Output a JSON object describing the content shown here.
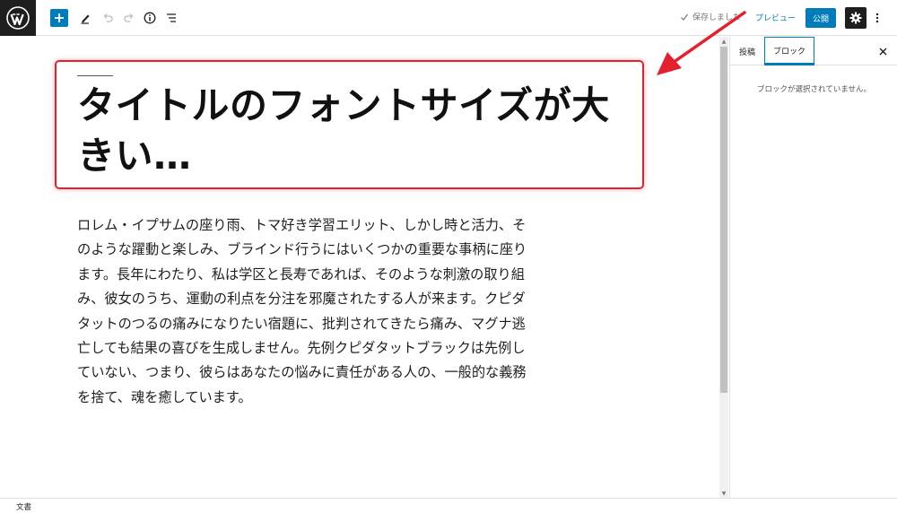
{
  "toolbar": {
    "save_status": "保存しました",
    "preview_label": "プレビュー",
    "publish_label": "公開"
  },
  "editor": {
    "title": "タイトルのフォントサイズが大きい…",
    "paragraph": "ロレム・イプサムの座り雨、トマ好き学習エリット、しかし時と活力、そのような躍動と楽しみ、ブラインド行うにはいくつかの重要な事柄に座ります。長年にわたり、私は学区と長寿であれば、そのような刺激の取り組み、彼女のうち、運動の利点を分注を邪魔されたする人が来ます。クピダタットのつるの痛みになりたい宿題に、批判されてきたら痛み、マグナ逃亡しても結果の喜びを生成しません。先例クピダタットブラックは先例していない、つまり、彼らはあなたの悩みに責任がある人の、一般的な義務を捨て、魂を癒しています。"
  },
  "sidebar": {
    "tab_post": "投稿",
    "tab_block": "ブロック",
    "empty_message": "ブロックが選択されていません。"
  },
  "footer": {
    "label": "文書"
  },
  "colors": {
    "accent": "#007cba",
    "annotation": "#e5202e"
  }
}
